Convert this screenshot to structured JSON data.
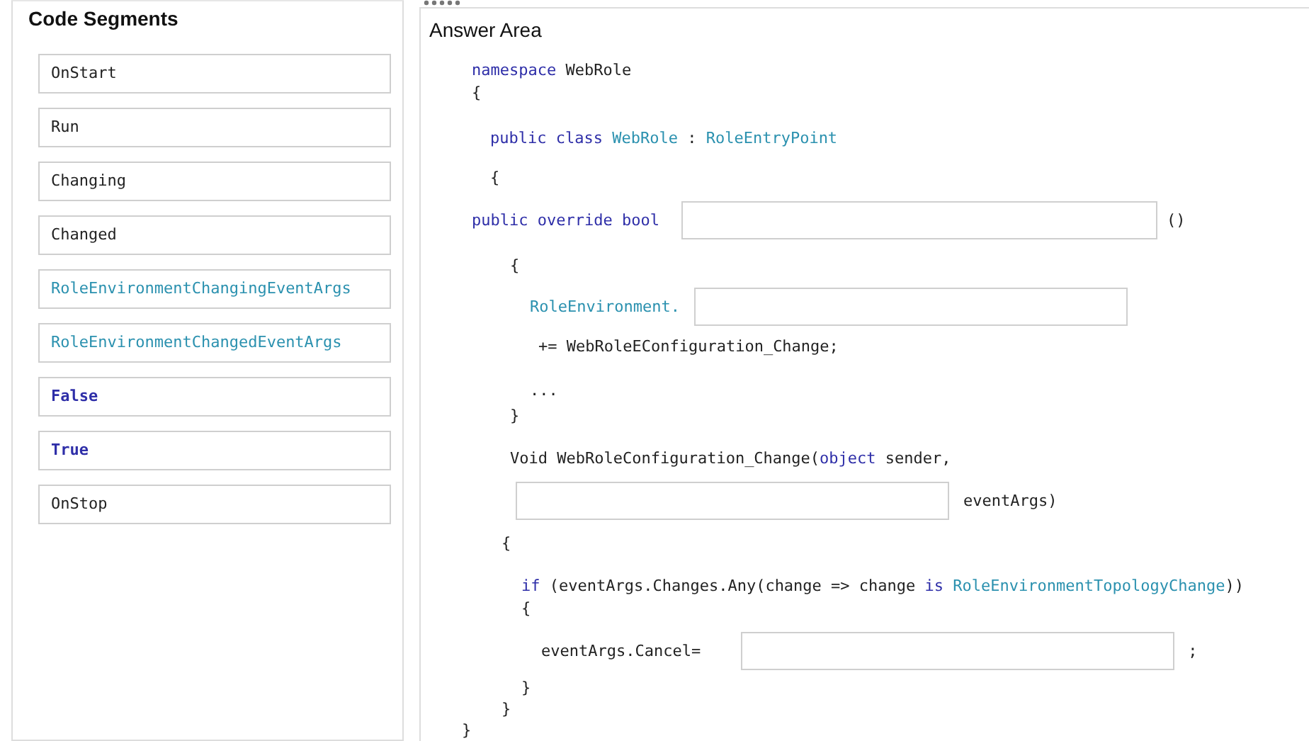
{
  "segments_panel": {
    "title": "Code Segments",
    "items": [
      {
        "text": "OnStart",
        "kind": "plain"
      },
      {
        "text": "Run",
        "kind": "plain"
      },
      {
        "text": "Changing",
        "kind": "plain"
      },
      {
        "text": "Changed",
        "kind": "plain"
      },
      {
        "text": "RoleEnvironmentChangingEventArgs",
        "kind": "type"
      },
      {
        "text": "RoleEnvironmentChangedEventArgs",
        "kind": "type"
      },
      {
        "text": "False",
        "kind": "keyword"
      },
      {
        "text": "True",
        "kind": "keyword"
      },
      {
        "text": "OnStop",
        "kind": "plain"
      }
    ]
  },
  "answer_area": {
    "title": "Answer Area",
    "code_lines": [
      {
        "parts": [
          {
            "kind": "keyword",
            "text": "namespace"
          },
          {
            "kind": "plain",
            "text": " WebRole"
          }
        ]
      },
      {
        "parts": [
          {
            "kind": "plain",
            "text": "{"
          }
        ]
      },
      {
        "parts": [
          {
            "kind": "keyword",
            "text": "public class"
          },
          {
            "kind": "type",
            "text": " WebRole"
          },
          {
            "kind": "plain",
            "text": " : "
          },
          {
            "kind": "type",
            "text": "RoleEntryPoint"
          }
        ]
      },
      {
        "parts": [
          {
            "kind": "plain",
            "text": "{"
          }
        ]
      },
      {
        "parts": [
          {
            "kind": "keyword",
            "text": "public override bool"
          },
          {
            "kind": "blank"
          },
          {
            "kind": "plain",
            "text": "()"
          }
        ]
      },
      {
        "parts": [
          {
            "kind": "plain",
            "text": "{"
          }
        ]
      },
      {
        "parts": [
          {
            "kind": "type",
            "text": "RoleEnvironment."
          },
          {
            "kind": "blank"
          }
        ]
      },
      {
        "parts": [
          {
            "kind": "plain",
            "text": "+= WebRoleEConfiguration_Change;"
          }
        ]
      },
      {
        "parts": [
          {
            "kind": "plain",
            "text": "..."
          }
        ]
      },
      {
        "parts": [
          {
            "kind": "plain",
            "text": "}"
          }
        ]
      },
      {
        "parts": [
          {
            "kind": "plain",
            "text": "Void WebRoleConfiguration_Change("
          },
          {
            "kind": "keyword",
            "text": "object"
          },
          {
            "kind": "plain",
            "text": " sender,"
          }
        ]
      },
      {
        "parts": [
          {
            "kind": "blank"
          },
          {
            "kind": "plain",
            "text": "eventArgs)"
          }
        ]
      },
      {
        "parts": [
          {
            "kind": "plain",
            "text": "{"
          }
        ]
      },
      {
        "parts": [
          {
            "kind": "keyword",
            "text": "if"
          },
          {
            "kind": "plain",
            "text": " (eventArgs.Changes.Any(change => change "
          },
          {
            "kind": "keyword",
            "text": "is"
          },
          {
            "kind": "type",
            "text": " RoleEnvironmentTopologyChange"
          },
          {
            "kind": "plain",
            "text": "))"
          }
        ]
      },
      {
        "parts": [
          {
            "kind": "plain",
            "text": "{"
          }
        ]
      },
      {
        "parts": [
          {
            "kind": "plain",
            "text": "eventArgs.Cancel="
          },
          {
            "kind": "blank"
          },
          {
            "kind": "plain",
            "text": ";"
          }
        ]
      },
      {
        "parts": [
          {
            "kind": "plain",
            "text": "}"
          }
        ]
      },
      {
        "parts": [
          {
            "kind": "plain",
            "text": "}"
          }
        ]
      },
      {
        "parts": [
          {
            "kind": "plain",
            "text": "}"
          }
        ]
      }
    ]
  }
}
